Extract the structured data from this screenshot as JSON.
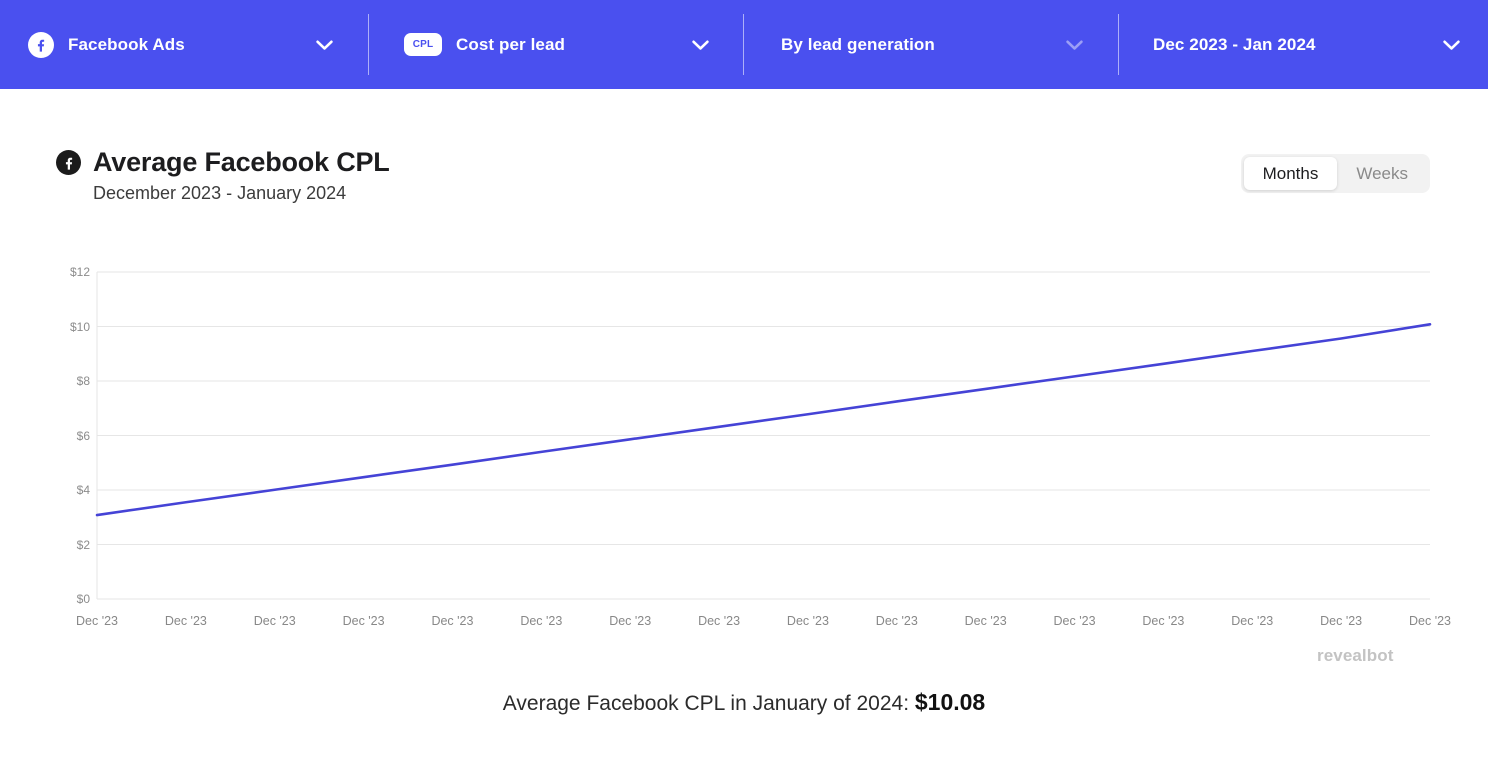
{
  "topbar": {
    "background": "#4a50ef",
    "segments": [
      {
        "label": "Facebook Ads",
        "icon": "facebook-icon",
        "chevron": "chevron-down-icon"
      },
      {
        "label": "Cost per lead",
        "badge": "CPL",
        "chevron": "chevron-down-icon"
      },
      {
        "label": "By lead generation",
        "chevron": "chevron-down-icon"
      },
      {
        "label": "Dec 2023 - Jan 2024",
        "chevron": "chevron-down-icon"
      }
    ]
  },
  "chart_header": {
    "title": "Average Facebook CPL",
    "subtitle": "December 2023 - January 2024",
    "icon": "facebook-icon"
  },
  "granularity_toggle": {
    "options": [
      "Months",
      "Weeks"
    ],
    "selected": "Months"
  },
  "watermark": "revealbot",
  "caption": {
    "prefix": "Average Facebook CPL in January of 2024: ",
    "value": "$10.08"
  },
  "chart_data": {
    "type": "line",
    "title": "Average Facebook CPL",
    "subtitle": "December 2023 - January 2024",
    "xlabel": "",
    "ylabel": "",
    "ylim": [
      0,
      12
    ],
    "yticks": [
      0,
      2,
      4,
      6,
      8,
      10,
      12
    ],
    "ytick_labels": [
      "$0",
      "$2",
      "$4",
      "$6",
      "$8",
      "$10",
      "$12"
    ],
    "grid": true,
    "legend": false,
    "line_color": "#4543d6",
    "categories": [
      "Dec '23",
      "Dec '23",
      "Dec '23",
      "Dec '23",
      "Dec '23",
      "Dec '23",
      "Dec '23",
      "Dec '23",
      "Dec '23",
      "Dec '23",
      "Dec '23",
      "Dec '23",
      "Dec '23",
      "Dec '23",
      "Dec '23",
      "Dec '23"
    ],
    "series": [
      {
        "name": "Average Facebook CPL",
        "values": [
          3.08,
          3.55,
          4.01,
          4.47,
          4.93,
          5.4,
          5.86,
          6.32,
          6.78,
          7.25,
          7.71,
          8.17,
          8.63,
          9.1,
          9.56,
          10.08
        ]
      }
    ]
  }
}
